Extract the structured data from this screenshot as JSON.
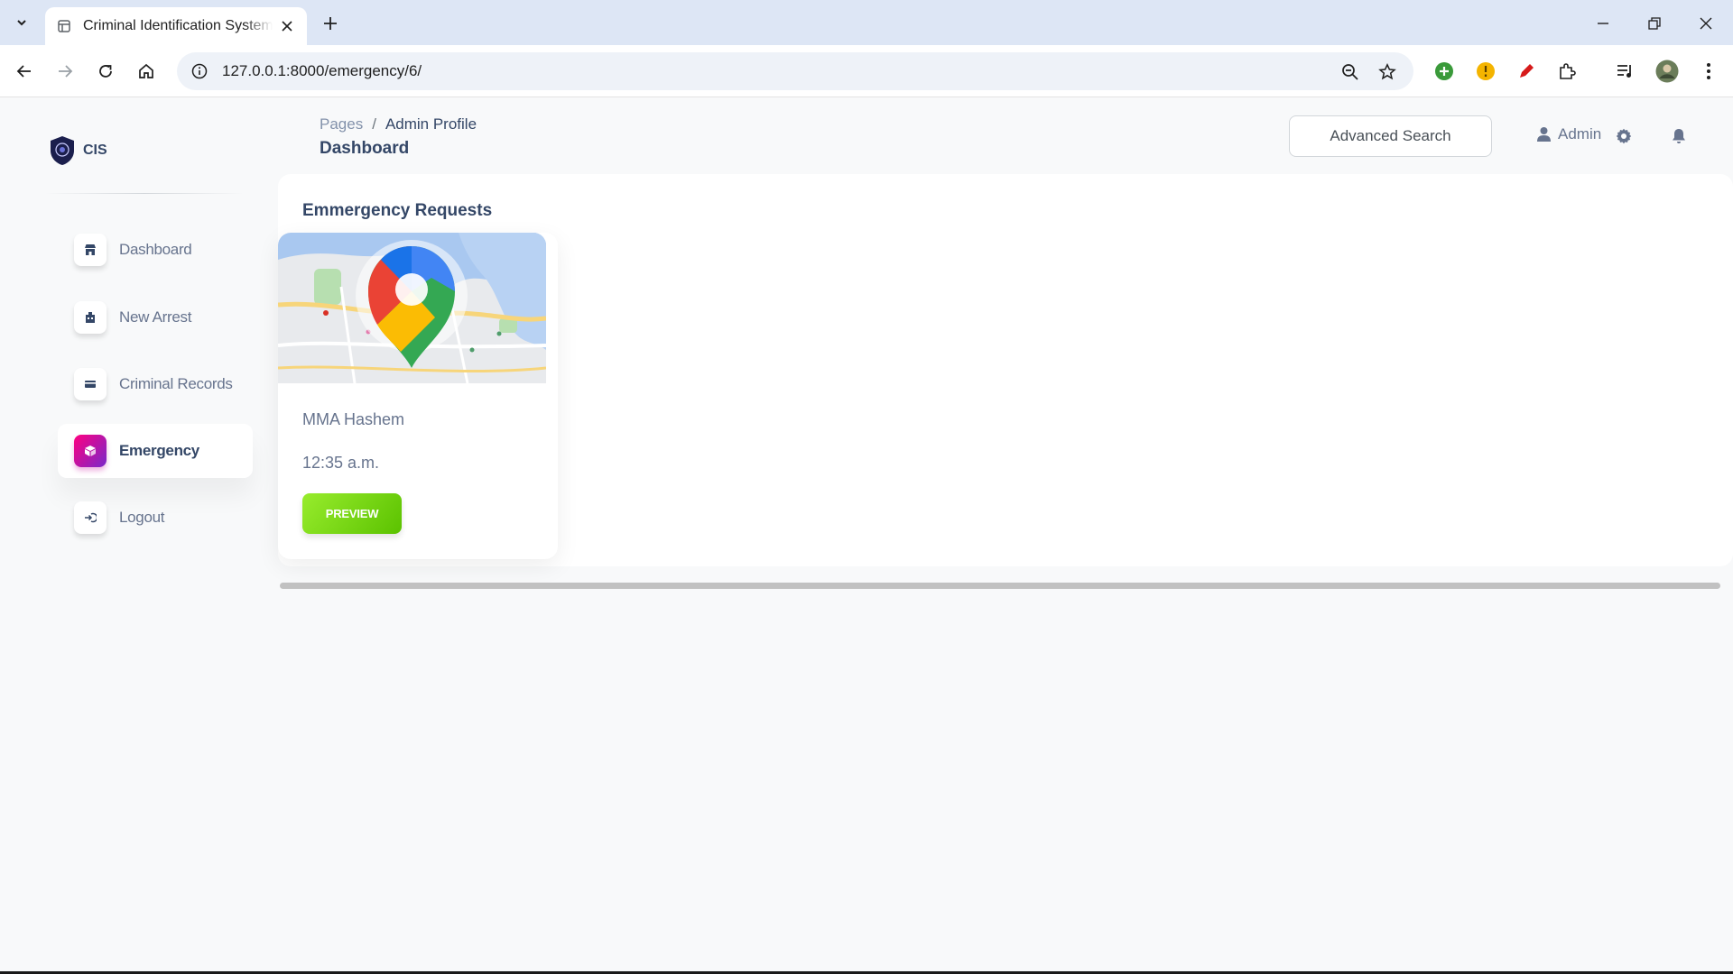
{
  "browser": {
    "tab_title": "Criminal Identification System - CIS",
    "url": "127.0.0.1:8000/emergency/6/"
  },
  "app": {
    "brand": "CIS",
    "sidebar": {
      "items": [
        {
          "label": "Dashboard",
          "icon": "shop-icon",
          "active": false
        },
        {
          "label": "New Arrest",
          "icon": "building-icon",
          "active": false
        },
        {
          "label": "Criminal Records",
          "icon": "credit-card-icon",
          "active": false
        },
        {
          "label": "Emergency",
          "icon": "box-icon",
          "active": true
        },
        {
          "label": "Logout",
          "icon": "logout-icon",
          "active": false
        }
      ]
    },
    "breadcrumb": {
      "root": "Pages",
      "separator": "/",
      "current": "Admin Profile"
    },
    "page_title": "Dashboard",
    "header": {
      "search_button": "Advanced Search",
      "user_label": "Admin"
    },
    "section_title": "Emmergency Requests",
    "requests": [
      {
        "name": "MMA Hashem",
        "time": "12:35 a.m.",
        "button": "PREVIEW"
      }
    ]
  },
  "colors": {
    "active_gradient_start": "#7928ca",
    "active_gradient_end": "#ff0080",
    "preview_button": "#82d616",
    "text_primary": "#344767",
    "text_secondary": "#67748e"
  }
}
